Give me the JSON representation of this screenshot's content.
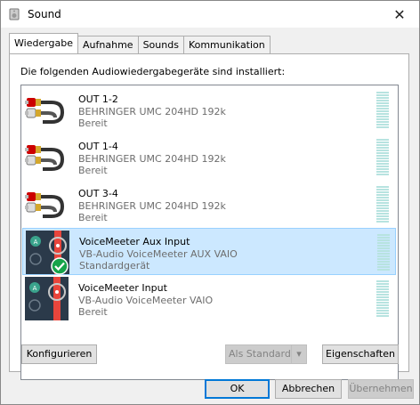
{
  "window": {
    "title": "Sound",
    "app_icon": "speaker-icon",
    "close_icon": "close-icon"
  },
  "tabs": [
    {
      "label": "Wiedergabe",
      "active": true
    },
    {
      "label": "Aufnahme",
      "active": false
    },
    {
      "label": "Sounds",
      "active": false
    },
    {
      "label": "Kommunikation",
      "active": false
    }
  ],
  "intro": "Die folgenden Audiowiedergabegeräte sind installiert:",
  "devices": [
    {
      "name": "OUT 1-2",
      "device": "BEHRINGER UMC 204HD 192k",
      "status": "Bereit",
      "icon": "rca-cable-icon",
      "selected": false
    },
    {
      "name": "OUT 1-4",
      "device": "BEHRINGER UMC 204HD 192k",
      "status": "Bereit",
      "icon": "rca-cable-icon",
      "selected": false
    },
    {
      "name": "OUT 3-4",
      "device": "BEHRINGER UMC 204HD 192k",
      "status": "Bereit",
      "icon": "rca-cable-icon",
      "selected": false
    },
    {
      "name": "VoiceMeeter Aux Input",
      "device": "VB-Audio VoiceMeeter AUX VAIO",
      "status": "Standardgerät",
      "icon": "voicemeeter-icon",
      "selected": true,
      "default_badge": "default-check-icon"
    },
    {
      "name": "VoiceMeeter Input",
      "device": "VB-Audio VoiceMeeter VAIO",
      "status": "Bereit",
      "icon": "voicemeeter-icon",
      "selected": false
    }
  ],
  "buttons": {
    "configure": "Konfigurieren",
    "set_default": "Als Standard",
    "properties": "Eigenschaften",
    "ok": "OK",
    "cancel": "Abbrechen",
    "apply": "Übernehmen"
  },
  "colors": {
    "selection": "#cce8ff",
    "accent": "#0078d7",
    "meter": "#b7e3e0",
    "voicemeeter_red": "#e8453c"
  }
}
